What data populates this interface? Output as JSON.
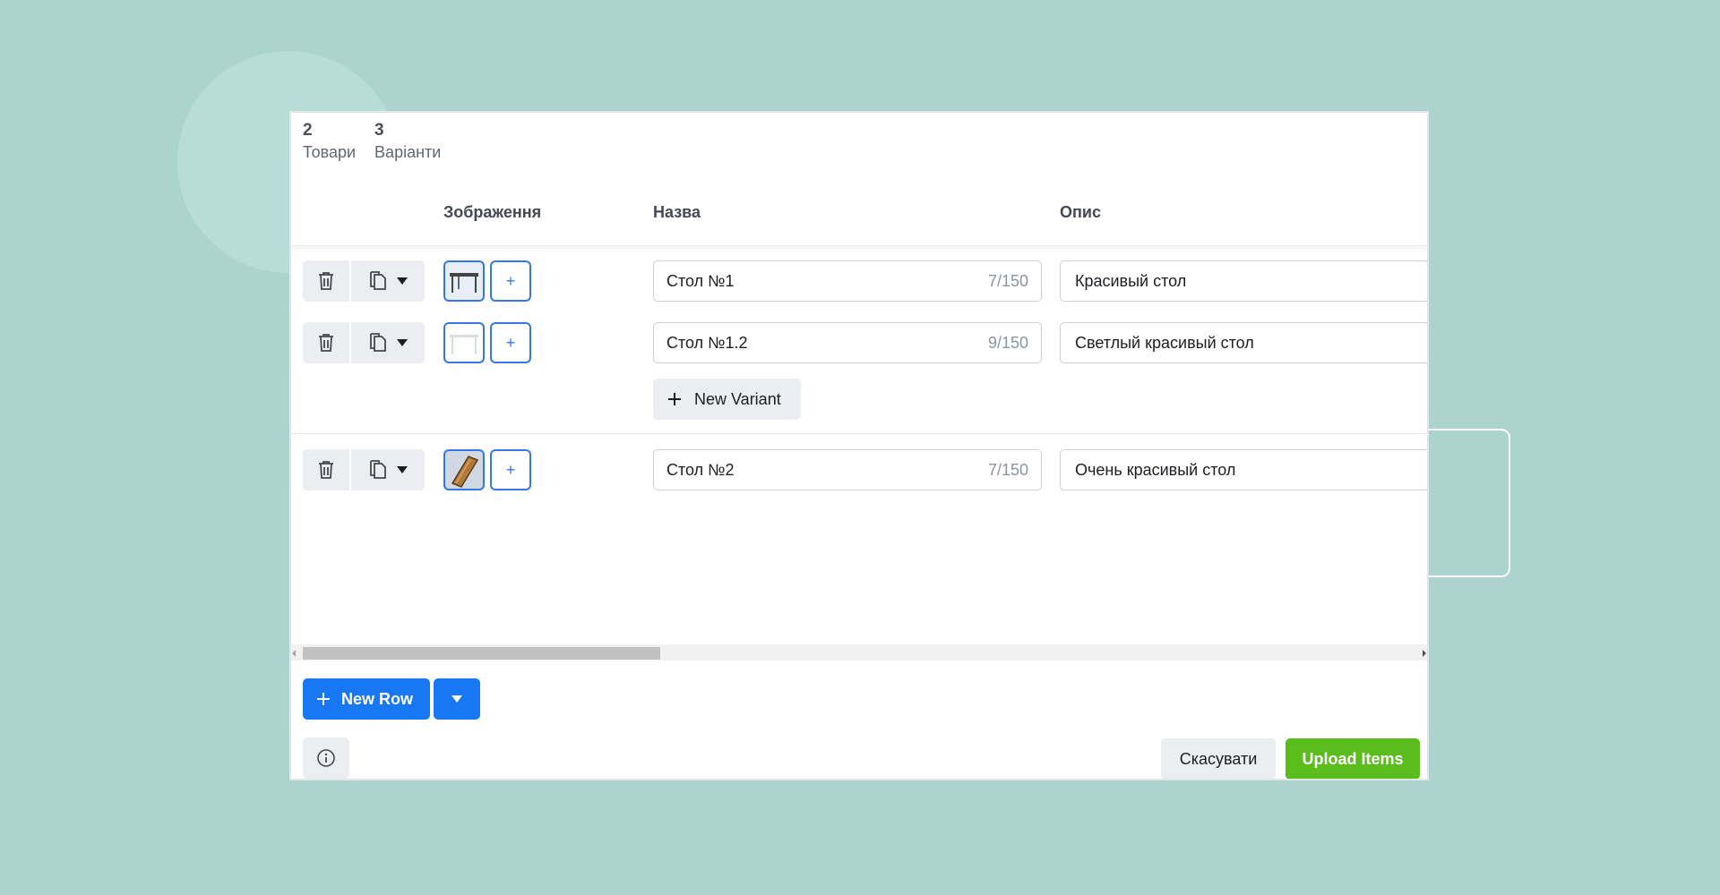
{
  "stats": [
    {
      "count": "2",
      "label": "Товари"
    },
    {
      "count": "3",
      "label": "Варіанти"
    }
  ],
  "columns": {
    "image": "Зображення",
    "name": "Назва",
    "description": "Опис"
  },
  "rows": [
    {
      "name": "Стол №1",
      "counter": "7/150",
      "description": "Красивый стол",
      "thumb": "dark-table"
    },
    {
      "name": "Стол №1.2",
      "counter": "9/150",
      "description": "Светлый красивый стол",
      "thumb": "white-table"
    },
    {
      "name": "Стол №2",
      "counter": "7/150",
      "description": "Очень красивый стол",
      "thumb": "wood-table"
    }
  ],
  "image_add_label": "+",
  "new_variant_label": "New Variant",
  "new_row_label": "New Row",
  "cancel_label": "Скасувати",
  "upload_label": "Upload Items",
  "colors": {
    "background": "#acd4cf",
    "accent_blue": "#1877f2",
    "upload_green": "#5bbd1c"
  },
  "icons": [
    "trash-icon",
    "duplicate-icon",
    "chevron-down-icon",
    "plus-icon",
    "info-icon"
  ]
}
